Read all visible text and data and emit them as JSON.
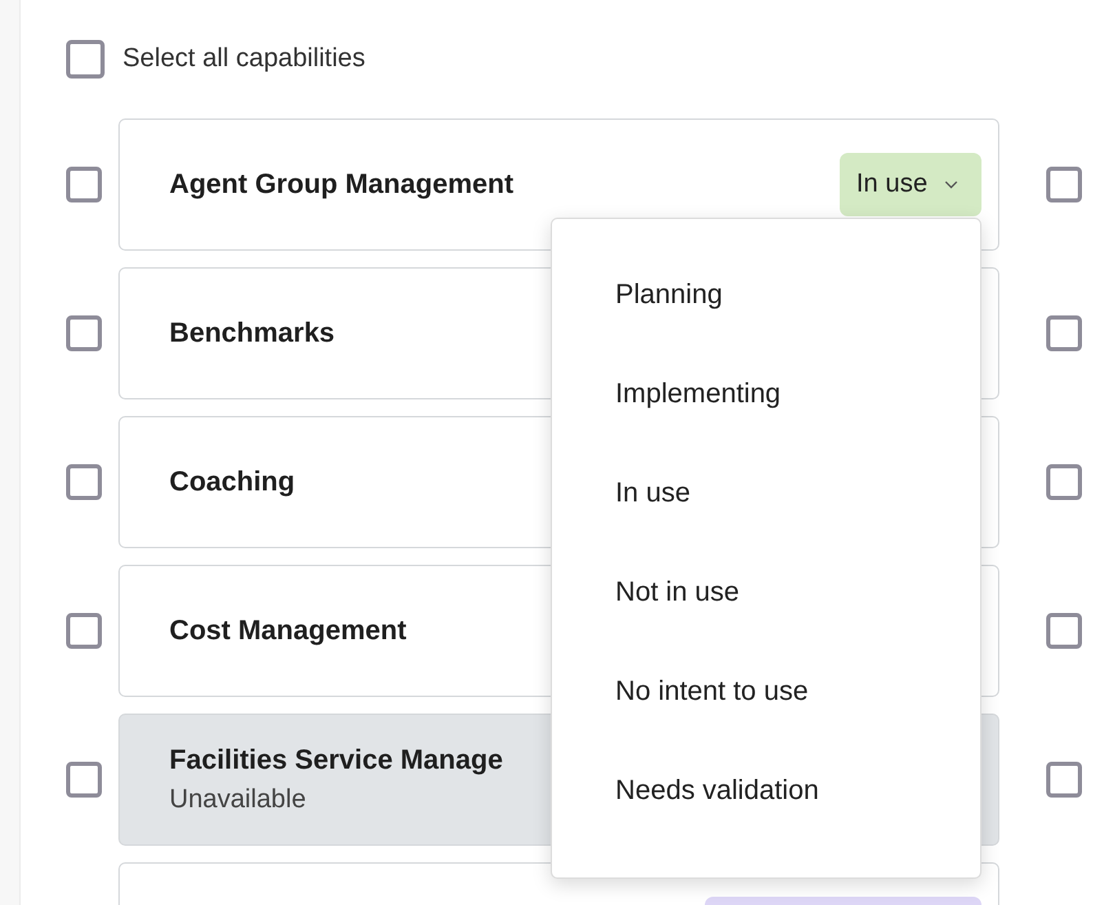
{
  "select_all": {
    "label": "Select all capabilities",
    "checked": false
  },
  "cards": [
    {
      "name": "Agent Group Management",
      "checked": false,
      "right_checked": false,
      "unavailable": false,
      "status": {
        "label": "In use",
        "color": "#d4eac4"
      }
    },
    {
      "name": "Benchmarks",
      "checked": false,
      "right_checked": false,
      "unavailable": false
    },
    {
      "name": "Coaching",
      "checked": false,
      "right_checked": false,
      "unavailable": false
    },
    {
      "name": "Cost Management",
      "checked": false,
      "right_checked": false,
      "unavailable": false
    },
    {
      "name": "Facilities Service Manage",
      "note": "Unavailable",
      "checked": false,
      "right_checked": false,
      "unavailable": true
    },
    {
      "unavailable": false,
      "status": {
        "color": "#ddd6f6"
      }
    }
  ],
  "status_menu": {
    "open": true,
    "options": [
      {
        "label": "Planning"
      },
      {
        "label": "Implementing"
      },
      {
        "label": "In use"
      },
      {
        "label": "Not in use"
      },
      {
        "label": "No intent to use"
      },
      {
        "label": "Needs validation"
      }
    ]
  }
}
